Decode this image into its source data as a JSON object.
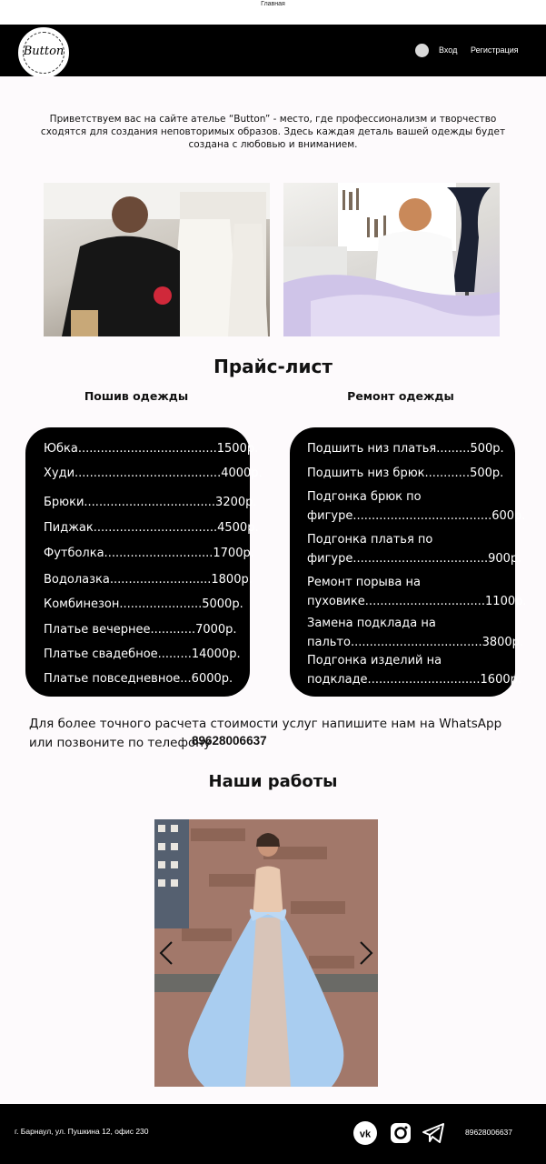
{
  "tab": {
    "title": "Главная"
  },
  "header": {
    "logo_text": "Button",
    "login_label": "Вход",
    "register_label": "Регистрация"
  },
  "welcome": {
    "text": "Приветствуем вас на сайте ателье “Button” - место, где профессионализм и творчество сходятся для создания неповторимых образов. Здесь каждая деталь вашей одежды будет создана с любовью и вниманием."
  },
  "price_list": {
    "title": "Прайс-лист",
    "sewing": {
      "title": "Пошив одежды",
      "items": [
        "Юбка.....................................1500р.",
        "Худи.......................................4000р.",
        "Брюки...................................3200р.",
        "Пиджак.................................4500р.",
        "Футболка.............................1700р.",
        "Водолазка...........................1800р.",
        "Комбинезон......................5000р.",
        "Платье вечернее............7000р.",
        "Платье свадебное.........14000р.",
        "Платье повседневное...6000р."
      ]
    },
    "repair": {
      "title": "Ремонт одежды",
      "items": [
        "Подшить низ платья.........500р.",
        "Подшить низ брюк............500р.",
        "Подгонка брюк по\nфигуре.....................................600р.",
        "Подгонка платья по\nфигуре....................................900р.",
        "Ремонт порыва на\nпуховике................................1100р.",
        "Замена подклада на\nпальто...................................3800р.",
        "Подгонка изделий на\nподкладе..............................1600р."
      ]
    }
  },
  "contact": {
    "note": "Для более точного расчета стоимости услуг напишите нам на WhatsApp или позвоните по телефону",
    "phone": "89628006637"
  },
  "works": {
    "title": "Наши работы"
  },
  "footer": {
    "address": "г. Барнаул, ул. Пушкина 12, офис 230",
    "phone": "89628006637"
  },
  "colors": {
    "header_bg": "#000000",
    "page_bg": "#fdfafc",
    "price_box_bg": "#000000",
    "dress_blue": "#a9cdf0"
  },
  "icons": {
    "social": [
      "vk-icon",
      "instagram-icon",
      "telegram-icon"
    ],
    "gallery_nav": [
      "chevron-left-icon",
      "chevron-right-icon"
    ]
  }
}
